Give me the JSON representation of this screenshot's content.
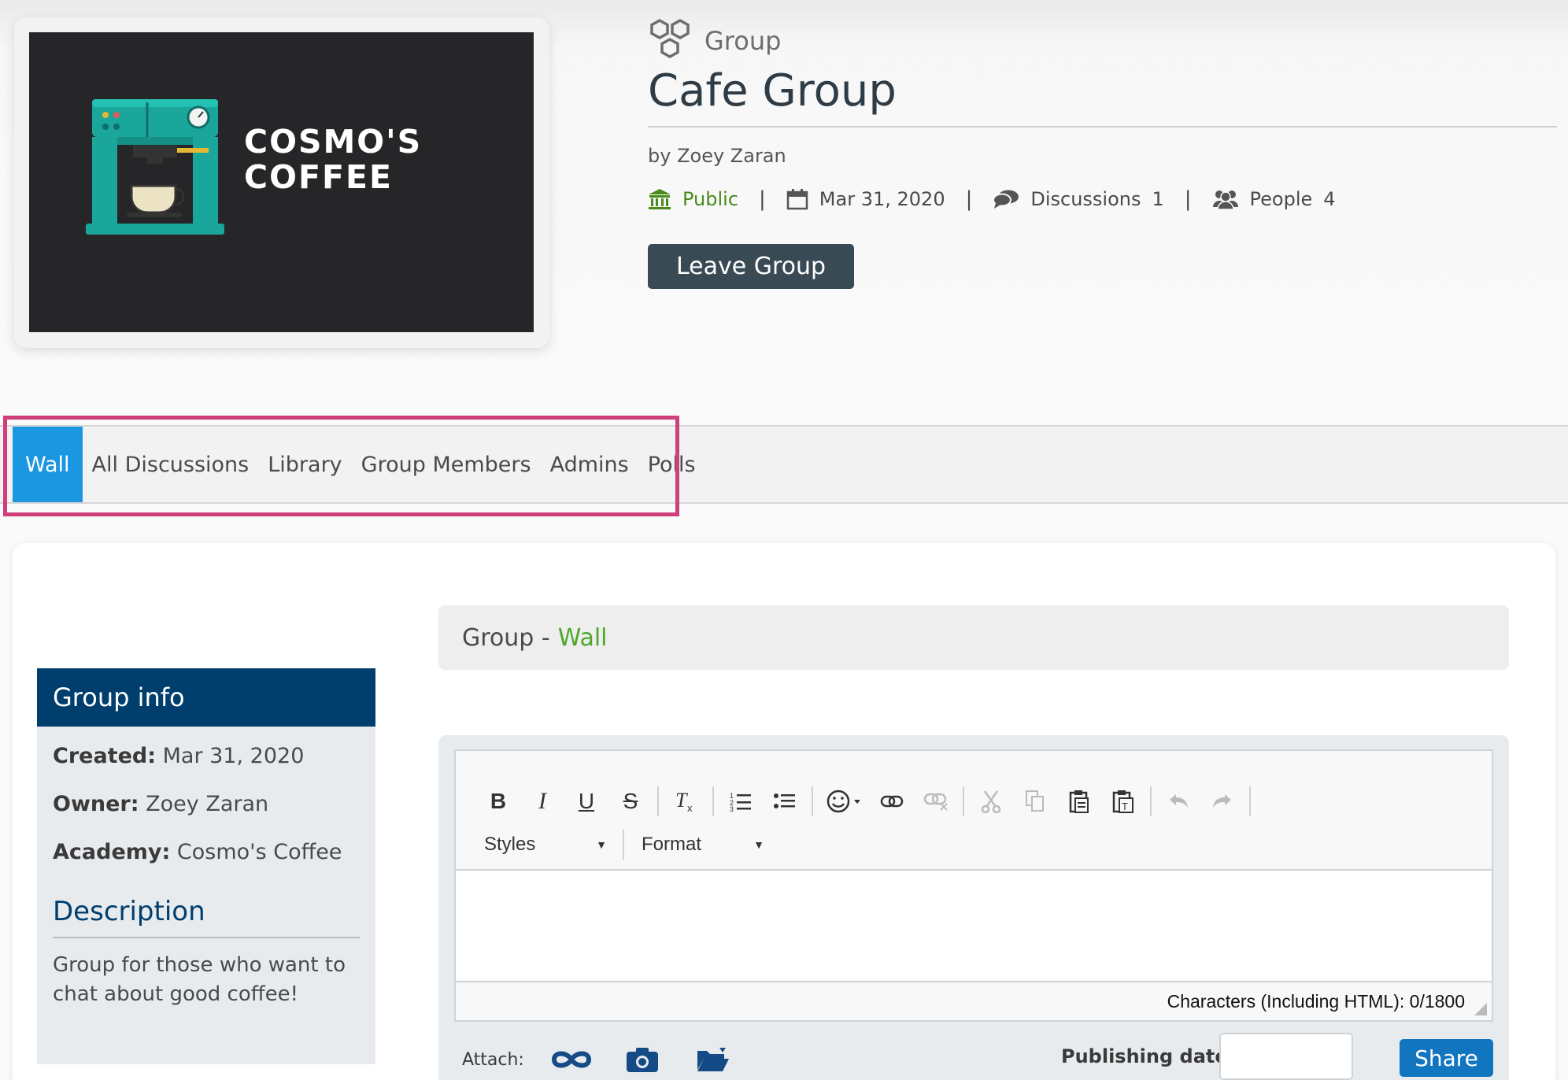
{
  "logo": {
    "line1": "COSMO'S",
    "line2": "COFFEE"
  },
  "header": {
    "type_label": "Group",
    "title": "Cafe Group",
    "byline": "by Zoey Zaran",
    "visibility": "Public",
    "date": "Mar 31, 2020",
    "discussions_label": "Discussions",
    "discussions_count": "1",
    "people_label": "People",
    "people_count": "4",
    "separator": "|",
    "leave_button": "Leave Group"
  },
  "tabs": [
    {
      "label": "Wall",
      "active": true
    },
    {
      "label": "All Discussions"
    },
    {
      "label": "Library"
    },
    {
      "label": "Group Members"
    },
    {
      "label": "Admins"
    },
    {
      "label": "Polls"
    }
  ],
  "group_info": {
    "heading": "Group info",
    "created_label": "Created:",
    "created_value": "Mar 31, 2020",
    "owner_label": "Owner:",
    "owner_value": "Zoey Zaran",
    "academy_label": "Academy:",
    "academy_value": "Cosmo's Coffee",
    "description_heading": "Description",
    "description": "Group for those who want to chat about good coffee!"
  },
  "wall": {
    "prefix": "Group -",
    "section": "Wall"
  },
  "editor": {
    "styles_label": "Styles",
    "format_label": "Format",
    "char_count": "Characters (Including HTML): 0/1800",
    "attach_label": "Attach:",
    "publishing_label": "Publishing date:",
    "publishing_value": "",
    "share_button": "Share"
  },
  "colors": {
    "accent_blue": "#1b96e0",
    "navy": "#003e6e",
    "public_green": "#4a8b1c",
    "button_dark": "#3a4a55",
    "share_blue": "#1175bf",
    "highlight_pink": "#cf3f7b"
  }
}
